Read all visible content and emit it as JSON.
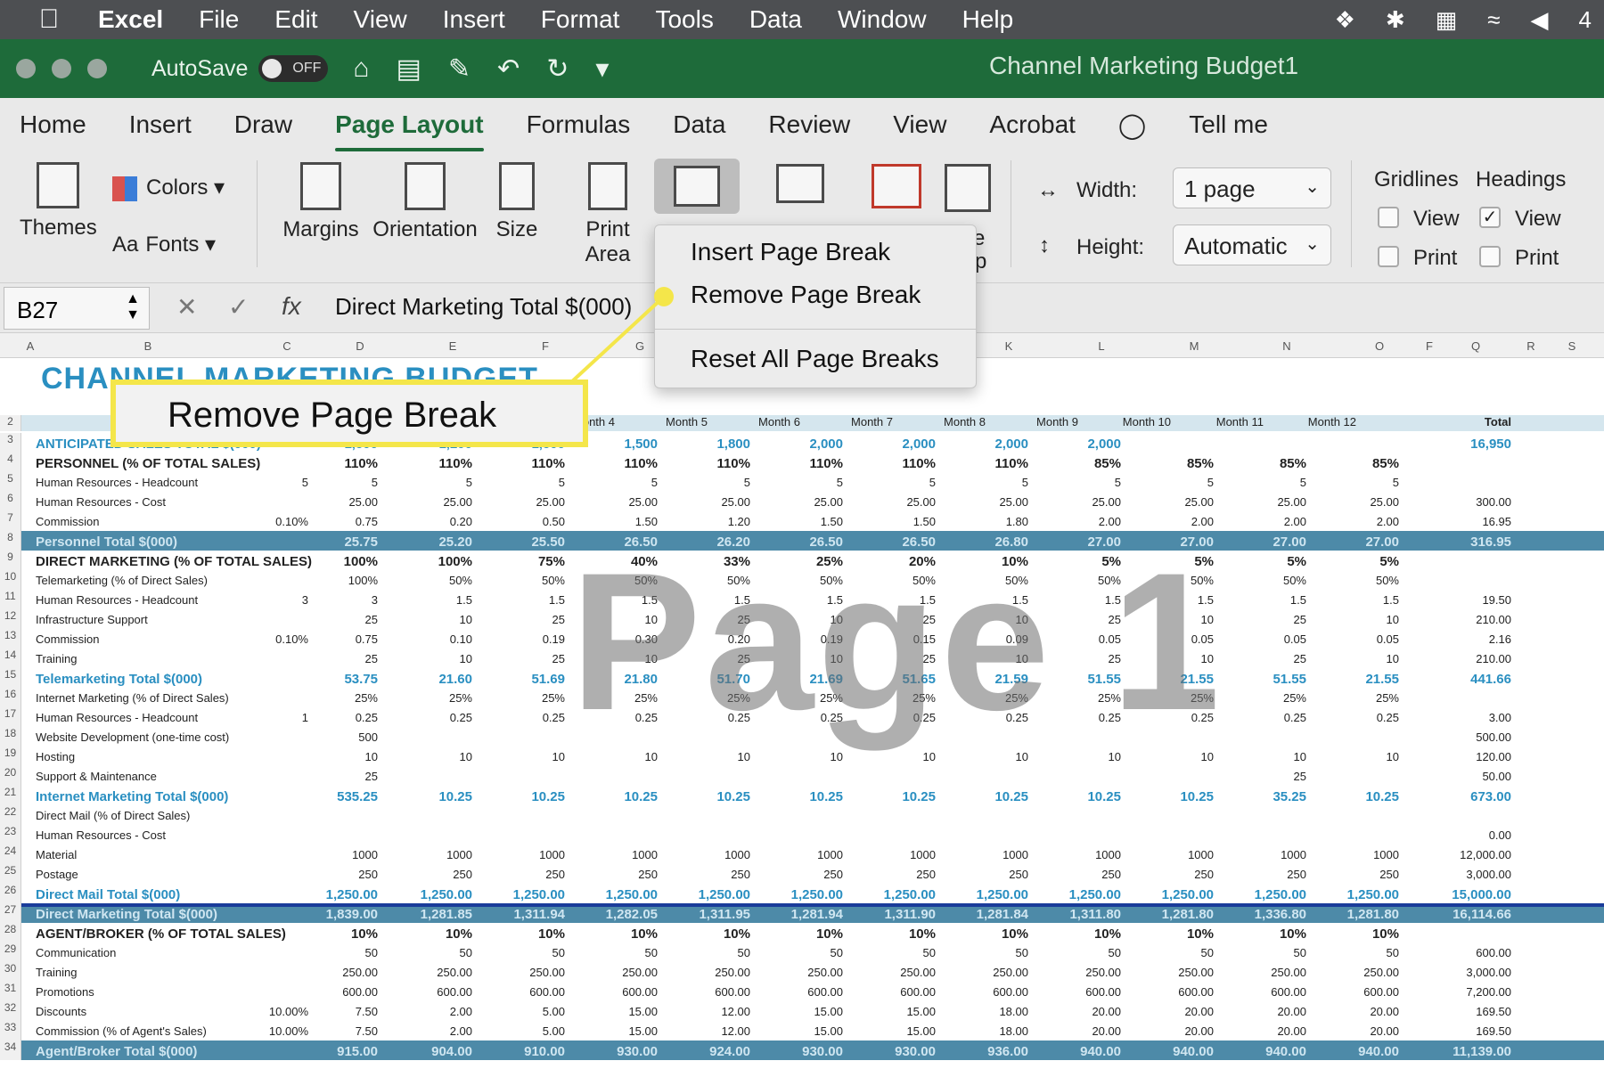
{
  "menubar": {
    "app": "Excel",
    "items": [
      "File",
      "Edit",
      "View",
      "Insert",
      "Format",
      "Tools",
      "Data",
      "Window",
      "Help"
    ],
    "right_tail": "4"
  },
  "titlebar": {
    "autosave_label": "AutoSave",
    "autosave_state": "OFF",
    "document_title": "Channel Marketing Budget1"
  },
  "tabs": [
    "Home",
    "Insert",
    "Draw",
    "Page Layout",
    "Formulas",
    "Data",
    "Review",
    "View",
    "Acrobat",
    "Tell me"
  ],
  "active_tab": "Page Layout",
  "ribbon": {
    "themes": "Themes",
    "colors": "Colors",
    "fonts": "Fonts",
    "margins": "Margins",
    "orientation": "Orientation",
    "size": "Size",
    "print_area": "Print Area",
    "width_label": "Width:",
    "width_value": "1 page",
    "height_label": "Height:",
    "height_value": "Automatic",
    "gridlines": "Gridlines",
    "headings": "Headings",
    "view": "View",
    "print": "Print",
    "partial_letters": [
      "e",
      "p"
    ]
  },
  "formula": {
    "cell_ref": "B27",
    "fx": "fx",
    "content": "Direct Marketing Total $(000)"
  },
  "dropdown": {
    "items": [
      "Insert Page Break",
      "Remove Page Break",
      "Reset All Page Breaks"
    ]
  },
  "callout": "Remove Page Break",
  "watermark": "Page 1",
  "sheet": {
    "columns": [
      "A",
      "B",
      "C",
      "D",
      "E",
      "F",
      "G",
      "K",
      "L",
      "M",
      "N",
      "O",
      "F",
      "Q",
      "R",
      "S"
    ],
    "title": "CHANNEL MARKETING BUDGET",
    "header_row": {
      "months": [
        "Month 4",
        "Month 5",
        "Month 6",
        "Month 7",
        "Month 8",
        "Month 9",
        "Month 10",
        "Month 11",
        "Month 12"
      ],
      "total": "Total"
    },
    "rows": [
      {
        "n": "3",
        "label": "ANTICIPATED SALES TOTAL $(000)",
        "vals": [
          "1,500",
          "1,200",
          "1,500",
          "1,500",
          "1,800",
          "2,000",
          "2,000",
          "2,000",
          "2,000"
        ],
        "total": "16,950",
        "style": "blue"
      },
      {
        "n": "4",
        "label": "PERSONNEL (% OF TOTAL SALES)",
        "vals": [
          "110%",
          "110%",
          "110%",
          "110%",
          "110%",
          "110%",
          "110%",
          "110%",
          "110%",
          "85%",
          "85%",
          "85%",
          "85%"
        ],
        "total": "",
        "style": "bold"
      },
      {
        "n": "5",
        "label": "Human Resources - Headcount",
        "c": "5",
        "vals": [
          "5",
          "5",
          "5",
          "5",
          "5",
          "5",
          "5",
          "5",
          "5",
          "5",
          "5",
          "5"
        ],
        "total": ""
      },
      {
        "n": "6",
        "label": "Human Resources - Cost",
        "vals": [
          "25.00",
          "25.00",
          "25.00",
          "25.00",
          "25.00",
          "25.00",
          "25.00",
          "25.00",
          "25.00",
          "25.00",
          "25.00",
          "25.00"
        ],
        "total": "300.00"
      },
      {
        "n": "7",
        "label": "Commission",
        "c": "0.10%",
        "vals": [
          "0.75",
          "0.20",
          "0.50",
          "1.50",
          "1.20",
          "1.50",
          "1.50",
          "1.80",
          "2.00",
          "2.00",
          "2.00",
          "2.00"
        ],
        "total": "16.95"
      },
      {
        "n": "8",
        "label": "Personnel Total $(000)",
        "vals": [
          "25.75",
          "25.20",
          "25.50",
          "26.50",
          "26.20",
          "26.50",
          "26.50",
          "26.80",
          "27.00",
          "27.00",
          "27.00",
          "27.00"
        ],
        "total": "316.95",
        "style": "teal"
      },
      {
        "n": "9",
        "label": "DIRECT MARKETING (% OF TOTAL SALES)",
        "vals": [
          "100%",
          "100%",
          "75%",
          "40%",
          "33%",
          "25%",
          "20%",
          "10%",
          "5%",
          "5%",
          "5%",
          "5%"
        ],
        "total": "",
        "style": "bold"
      },
      {
        "n": "10",
        "label": "Telemarketing (% of Direct Sales)",
        "vals": [
          "100%",
          "50%",
          "50%",
          "50%",
          "50%",
          "50%",
          "50%",
          "50%",
          "50%",
          "50%",
          "50%",
          "50%"
        ],
        "total": ""
      },
      {
        "n": "11",
        "label": "   Human Resources - Headcount",
        "c": "3",
        "vals": [
          "3",
          "1.5",
          "1.5",
          "1.5",
          "1.5",
          "1.5",
          "1.5",
          "1.5",
          "1.5",
          "1.5",
          "1.5",
          "1.5"
        ],
        "total": "19.50"
      },
      {
        "n": "12",
        "label": "   Infrastructure Support",
        "vals": [
          "25",
          "10",
          "25",
          "10",
          "25",
          "10",
          "25",
          "10",
          "25",
          "10",
          "25",
          "10"
        ],
        "total": "210.00"
      },
      {
        "n": "13",
        "label": "   Commission",
        "c": "0.10%",
        "vals": [
          "0.75",
          "0.10",
          "0.19",
          "0.30",
          "0.20",
          "0.19",
          "0.15",
          "0.09",
          "0.05",
          "0.05",
          "0.05",
          "0.05"
        ],
        "total": "2.16"
      },
      {
        "n": "14",
        "label": "   Training",
        "vals": [
          "25",
          "10",
          "25",
          "10",
          "25",
          "10",
          "25",
          "10",
          "25",
          "10",
          "25",
          "10"
        ],
        "total": "210.00"
      },
      {
        "n": "15",
        "label": "Telemarketing Total $(000)",
        "vals": [
          "53.75",
          "21.60",
          "51.69",
          "21.80",
          "51.70",
          "21.69",
          "51.65",
          "21.59",
          "51.55",
          "21.55",
          "51.55",
          "21.55"
        ],
        "total": "441.66",
        "style": "blue"
      },
      {
        "n": "16",
        "label": "Internet Marketing (% of Direct Sales)",
        "vals": [
          "25%",
          "25%",
          "25%",
          "25%",
          "25%",
          "25%",
          "25%",
          "25%",
          "25%",
          "25%",
          "25%",
          "25%"
        ],
        "total": ""
      },
      {
        "n": "17",
        "label": "   Human Resources - Headcount",
        "c": "1",
        "vals": [
          "0.25",
          "0.25",
          "0.25",
          "0.25",
          "0.25",
          "0.25",
          "0.25",
          "0.25",
          "0.25",
          "0.25",
          "0.25",
          "0.25"
        ],
        "total": "3.00"
      },
      {
        "n": "18",
        "label": "   Website Development (one-time cost)",
        "vals": [
          "500",
          "",
          "",
          "",
          "",
          "",
          "",
          "",
          "",
          "",
          "",
          ""
        ],
        "total": "500.00"
      },
      {
        "n": "19",
        "label": "   Hosting",
        "vals": [
          "10",
          "10",
          "10",
          "10",
          "10",
          "10",
          "10",
          "10",
          "10",
          "10",
          "10",
          "10"
        ],
        "total": "120.00"
      },
      {
        "n": "20",
        "label": "   Support & Maintenance",
        "vals": [
          "25",
          "",
          "",
          "",
          "",
          "",
          "",
          "",
          "",
          "",
          "25",
          ""
        ],
        "total": "50.00"
      },
      {
        "n": "21",
        "label": "Internet Marketing Total $(000)",
        "vals": [
          "535.25",
          "10.25",
          "10.25",
          "10.25",
          "10.25",
          "10.25",
          "10.25",
          "10.25",
          "10.25",
          "10.25",
          "35.25",
          "10.25"
        ],
        "total": "673.00",
        "style": "blue"
      },
      {
        "n": "22",
        "label": "Direct Mail (% of Direct Sales)",
        "vals": [
          "",
          "",
          "",
          "",
          "",
          "",
          "",
          "",
          "",
          "",
          "",
          ""
        ],
        "total": ""
      },
      {
        "n": "23",
        "label": "   Human Resources - Cost",
        "vals": [
          "",
          "",
          "",
          "",
          "",
          "",
          "",
          "",
          "",
          "",
          "",
          ""
        ],
        "total": "0.00"
      },
      {
        "n": "24",
        "label": "   Material",
        "vals": [
          "1000",
          "1000",
          "1000",
          "1000",
          "1000",
          "1000",
          "1000",
          "1000",
          "1000",
          "1000",
          "1000",
          "1000"
        ],
        "total": "12,000.00"
      },
      {
        "n": "25",
        "label": "   Postage",
        "vals": [
          "250",
          "250",
          "250",
          "250",
          "250",
          "250",
          "250",
          "250",
          "250",
          "250",
          "250",
          "250"
        ],
        "total": "3,000.00"
      },
      {
        "n": "26",
        "label": "Direct Mail Total $(000)",
        "vals": [
          "1,250.00",
          "1,250.00",
          "1,250.00",
          "1,250.00",
          "1,250.00",
          "1,250.00",
          "1,250.00",
          "1,250.00",
          "1,250.00",
          "1,250.00",
          "1,250.00",
          "1,250.00"
        ],
        "total": "15,000.00",
        "style": "blue"
      },
      {
        "n": "27",
        "label": "Direct Marketing Total $(000)",
        "vals": [
          "1,839.00",
          "1,281.85",
          "1,311.94",
          "1,282.05",
          "1,311.95",
          "1,281.94",
          "1,311.90",
          "1,281.84",
          "1,311.80",
          "1,281.80",
          "1,336.80",
          "1,281.80"
        ],
        "total": "16,114.66",
        "style": "teal"
      },
      {
        "n": "28",
        "label": "AGENT/BROKER (% OF TOTAL SALES)",
        "vals": [
          "10%",
          "10%",
          "10%",
          "10%",
          "10%",
          "10%",
          "10%",
          "10%",
          "10%",
          "10%",
          "10%",
          "10%"
        ],
        "total": "",
        "style": "bold"
      },
      {
        "n": "29",
        "label": "Communication",
        "vals": [
          "50",
          "50",
          "50",
          "50",
          "50",
          "50",
          "50",
          "50",
          "50",
          "50",
          "50",
          "50"
        ],
        "total": "600.00"
      },
      {
        "n": "30",
        "label": "Training",
        "vals": [
          "250.00",
          "250.00",
          "250.00",
          "250.00",
          "250.00",
          "250.00",
          "250.00",
          "250.00",
          "250.00",
          "250.00",
          "250.00",
          "250.00"
        ],
        "total": "3,000.00"
      },
      {
        "n": "31",
        "label": "Promotions",
        "vals": [
          "600.00",
          "600.00",
          "600.00",
          "600.00",
          "600.00",
          "600.00",
          "600.00",
          "600.00",
          "600.00",
          "600.00",
          "600.00",
          "600.00"
        ],
        "total": "7,200.00"
      },
      {
        "n": "32",
        "label": "Discounts",
        "c": "10.00%",
        "vals": [
          "7.50",
          "2.00",
          "5.00",
          "15.00",
          "12.00",
          "15.00",
          "15.00",
          "18.00",
          "20.00",
          "20.00",
          "20.00",
          "20.00"
        ],
        "total": "169.50"
      },
      {
        "n": "33",
        "label": "Commission (% of Agent's Sales)",
        "c": "10.00%",
        "vals": [
          "7.50",
          "2.00",
          "5.00",
          "15.00",
          "12.00",
          "15.00",
          "15.00",
          "18.00",
          "20.00",
          "20.00",
          "20.00",
          "20.00"
        ],
        "total": "169.50"
      },
      {
        "n": "34",
        "label": "Agent/Broker Total $(000)",
        "vals": [
          "915.00",
          "904.00",
          "910.00",
          "930.00",
          "924.00",
          "930.00",
          "930.00",
          "936.00",
          "940.00",
          "940.00",
          "940.00",
          "940.00"
        ],
        "total": "11,139.00",
        "style": "teal"
      }
    ]
  }
}
